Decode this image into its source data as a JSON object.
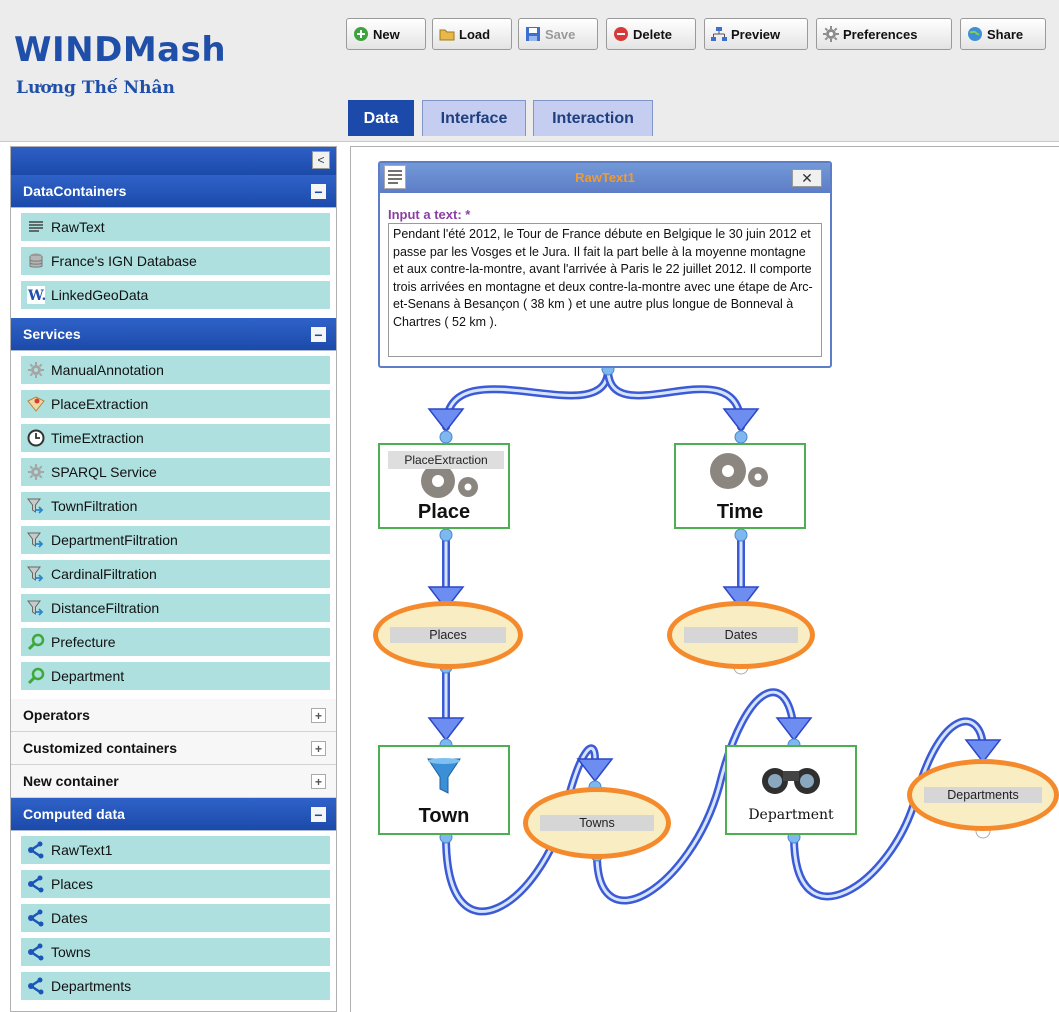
{
  "header": {
    "app_title": "WINDMash",
    "author": "Lương Thế Nhân",
    "toolbar": {
      "new": "New",
      "load": "Load",
      "save": "Save",
      "delete": "Delete",
      "preview": "Preview",
      "preferences": "Preferences",
      "share": "Share"
    },
    "tabs": [
      {
        "label": "Data",
        "active": true
      },
      {
        "label": "Interface",
        "active": false
      },
      {
        "label": "Interaction",
        "active": false
      }
    ]
  },
  "sidebar": {
    "collapse_label": "<",
    "sections": [
      {
        "title": "DataContainers",
        "toggle": "−",
        "items": [
          {
            "label": "RawText",
            "icon": "text-lines-icon"
          },
          {
            "label": "France's IGN Database",
            "icon": "database-icon"
          },
          {
            "label": "LinkedGeoData",
            "icon": "w-logo-icon"
          }
        ]
      },
      {
        "title": "Services",
        "toggle": "−",
        "items": [
          {
            "label": "ManualAnnotation",
            "icon": "gear-icon"
          },
          {
            "label": "PlaceExtraction",
            "icon": "map-pin-icon"
          },
          {
            "label": "TimeExtraction",
            "icon": "clock-icon"
          },
          {
            "label": "SPARQL Service",
            "icon": "gear-icon"
          },
          {
            "label": "TownFiltration",
            "icon": "funnel-icon"
          },
          {
            "label": "DepartmentFiltration",
            "icon": "funnel-icon"
          },
          {
            "label": "CardinalFiltration",
            "icon": "funnel-icon"
          },
          {
            "label": "DistanceFiltration",
            "icon": "funnel-icon"
          },
          {
            "label": "Prefecture",
            "icon": "magnifier-icon"
          },
          {
            "label": "Department",
            "icon": "magnifier-icon"
          }
        ]
      },
      {
        "title": "Operators",
        "toggle": "+"
      },
      {
        "title": "Customized containers",
        "toggle": "+"
      },
      {
        "title": "New container",
        "toggle": "+"
      },
      {
        "title": "Computed data",
        "toggle": "−",
        "items": [
          {
            "label": "RawText1",
            "icon": "share-icon"
          },
          {
            "label": "Places",
            "icon": "share-icon"
          },
          {
            "label": "Dates",
            "icon": "share-icon"
          },
          {
            "label": "Towns",
            "icon": "share-icon"
          },
          {
            "label": "Departments",
            "icon": "share-icon"
          }
        ]
      }
    ]
  },
  "canvas": {
    "rawtext": {
      "title": "RawText1",
      "close": "✕",
      "input_label": "Input a text: *",
      "text": "Pendant l'été 2012, le Tour de France débute en Belgique le 30 juin 2012 et passe par les Vosges et le Jura. Il fait la part belle à la moyenne montagne et aux contre-la-montre, avant l'arrivée à Paris le 22 juillet 2012. Il comporte trois arrivées en montagne et deux contre-la-montre avec une étape de Arc-et-Senans à Besançon ( 38 km ) et une autre plus longue de Bonneval à Chartres ( 52 km )."
    },
    "place": {
      "label": "Place",
      "tooltip": "PlaceExtraction"
    },
    "time": {
      "label": "Time"
    },
    "places": {
      "label": "Places"
    },
    "dates": {
      "label": "Dates"
    },
    "town": {
      "label": "Town"
    },
    "towns": {
      "label": "Towns"
    },
    "department": {
      "label": "Department"
    },
    "departments": {
      "label": "Departments"
    }
  },
  "colors": {
    "brand_blue": "#1b4aaa",
    "item_bg": "#aee0e0",
    "service_border": "#4caf50",
    "data_ellipse": "#f58a2c",
    "wire": "#3c5ad6"
  }
}
